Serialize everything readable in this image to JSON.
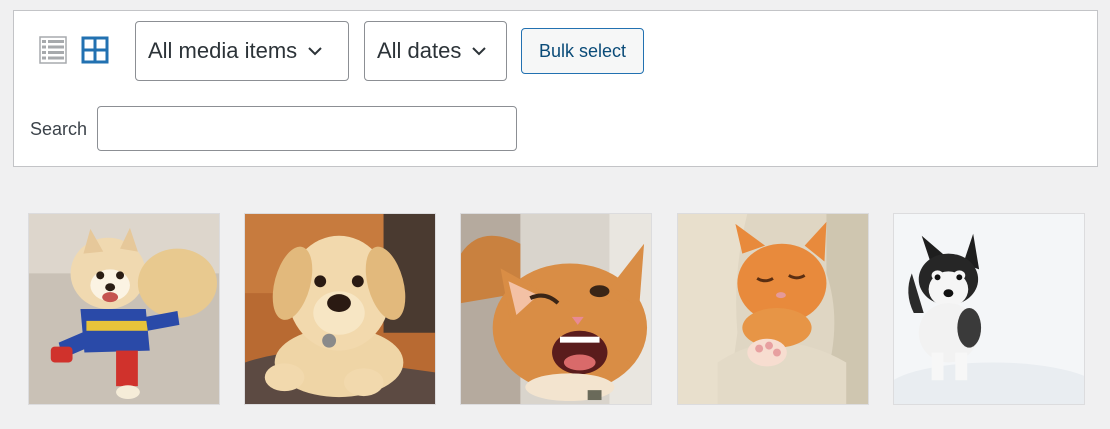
{
  "toolbar": {
    "view_modes": [
      {
        "name": "list",
        "icon": "list-icon",
        "active": false
      },
      {
        "name": "grid",
        "icon": "grid-icon",
        "active": true
      }
    ],
    "media_filter": {
      "selected": "All media items"
    },
    "date_filter": {
      "selected": "All dates"
    },
    "bulk_select_label": "Bulk select",
    "search": {
      "label": "Search",
      "value": "",
      "placeholder": ""
    }
  },
  "attachments": [
    {
      "subject": "pomeranian puppy in superhero costume"
    },
    {
      "subject": "labrador puppy"
    },
    {
      "subject": "winking orange cat"
    },
    {
      "subject": "sleeping orange kitten"
    },
    {
      "subject": "husky puppy in snow"
    }
  ],
  "colors": {
    "accent": "#2271b1",
    "background": "#f0f0f1",
    "panel": "#ffffff",
    "border": "#c3c4c7"
  }
}
